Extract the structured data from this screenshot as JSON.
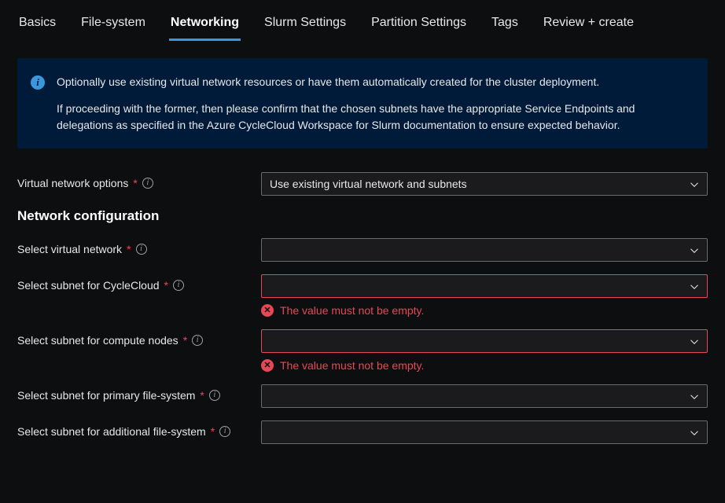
{
  "tabs": [
    {
      "label": "Basics"
    },
    {
      "label": "File-system"
    },
    {
      "label": "Networking"
    },
    {
      "label": "Slurm Settings"
    },
    {
      "label": "Partition Settings"
    },
    {
      "label": "Tags"
    },
    {
      "label": "Review + create"
    }
  ],
  "active_tab_index": 2,
  "info": {
    "line1": "Optionally use existing virtual network resources or have them automatically created for the cluster deployment.",
    "line2": "If proceeding with the former, then please confirm that the chosen subnets have the appropriate Service Endpoints and delegations as specified in the Azure CycleCloud Workspace for Slurm documentation to ensure expected behavior."
  },
  "fields": {
    "vnet_options": {
      "label": "Virtual network options",
      "value": "Use existing virtual network and subnets",
      "required": true
    },
    "section_heading": "Network configuration",
    "select_vnet": {
      "label": "Select virtual network",
      "value": "",
      "required": true
    },
    "subnet_cyclecloud": {
      "label": "Select subnet for CycleCloud",
      "value": "",
      "required": true,
      "error": "The value must not be empty."
    },
    "subnet_compute": {
      "label": "Select subnet for compute nodes",
      "value": "",
      "required": true,
      "error": "The value must not be empty."
    },
    "subnet_primary_fs": {
      "label": "Select subnet for primary file-system",
      "value": "",
      "required": true
    },
    "subnet_additional_fs": {
      "label": "Select subnet for additional file-system",
      "value": "",
      "required": true
    }
  }
}
